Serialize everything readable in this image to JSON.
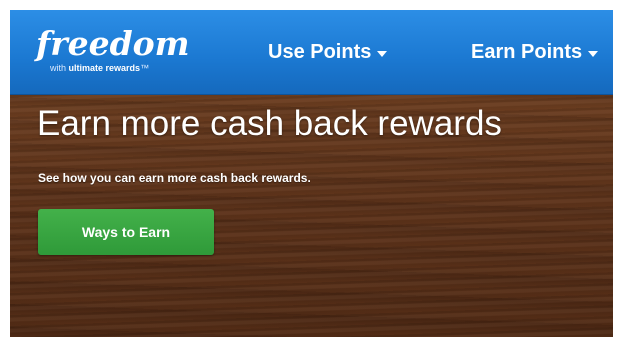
{
  "header": {
    "logo": {
      "word": "freedom",
      "tm": "·",
      "sub_prefix": "with",
      "sub_brand": "ultimate rewards",
      "sub_suffix": "™"
    },
    "nav": [
      {
        "label": "Use Points"
      },
      {
        "label": "Earn Points"
      }
    ]
  },
  "hero": {
    "title": "Earn more cash back rewards",
    "subtitle": "See how you can earn more cash back rewards.",
    "cta_label": "Ways to Earn"
  },
  "colors": {
    "header_blue": "#1b78d1",
    "cta_green": "#3aa843",
    "wood_brown": "#5b321a"
  },
  "icons": [
    "chevron-down-icon"
  ]
}
